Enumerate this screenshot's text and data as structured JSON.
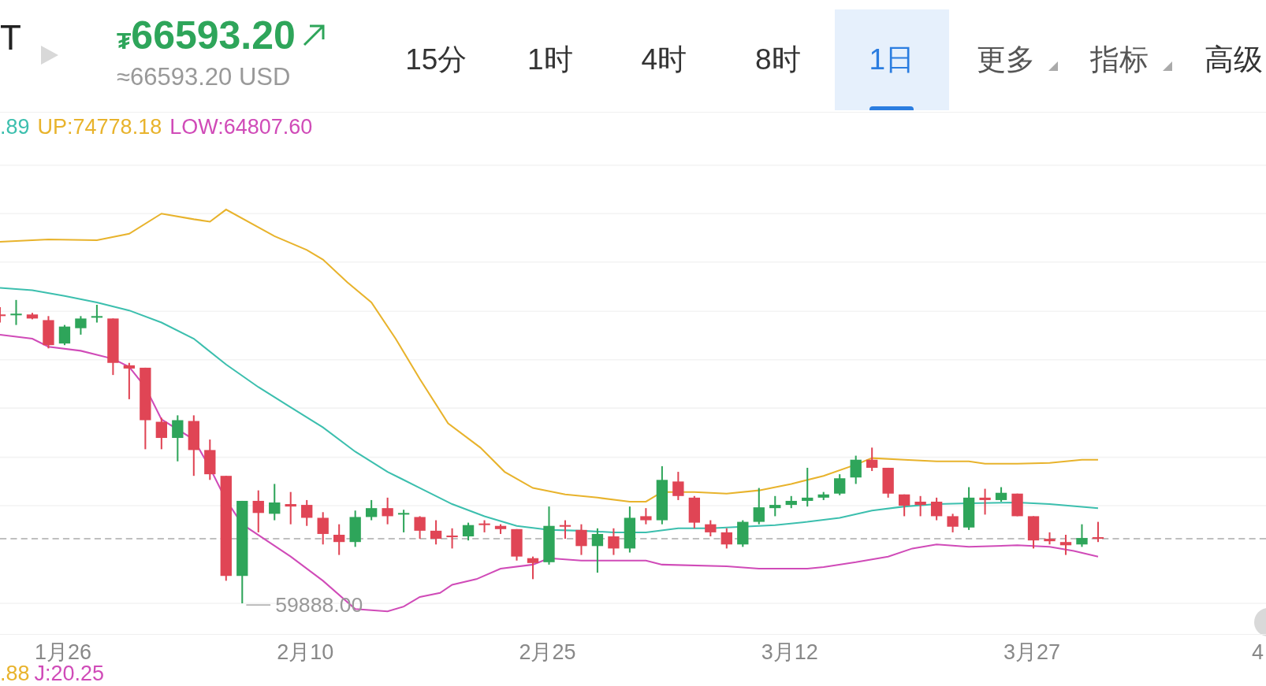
{
  "header": {
    "symbol": "T",
    "price_currency": "₮",
    "price": "66593.20",
    "converted": "≈66593.20 USD"
  },
  "tabs": [
    {
      "label": "15分",
      "kind": "interval",
      "selected": false
    },
    {
      "label": "1时",
      "kind": "interval",
      "selected": false
    },
    {
      "label": "4时",
      "kind": "interval",
      "selected": false
    },
    {
      "label": "8时",
      "kind": "interval",
      "selected": false
    },
    {
      "label": "1日",
      "kind": "interval",
      "selected": true
    },
    {
      "label": "更多",
      "kind": "dropdown",
      "selected": false
    },
    {
      "label": "指标",
      "kind": "dropdown",
      "selected": false
    },
    {
      "label": "高级",
      "kind": "interval",
      "selected": false
    }
  ],
  "indicators": [
    {
      "text": ".89",
      "color": "#3cbfae"
    },
    {
      "text": "UP:74778.18",
      "color": "#e8b32c"
    },
    {
      "text": "LOW:64807.60",
      "color": "#d04bb8"
    }
  ],
  "chart": {
    "low_label": "59888.00",
    "x_labels": [
      "1月26",
      "2月10",
      "2月25",
      "3月12",
      "3月27",
      "4"
    ]
  },
  "sub_indicators": [
    {
      "text": ".88",
      "color": "#e8b32c"
    },
    {
      "text": "J:20.25",
      "color": "#d04bb8"
    }
  ]
}
